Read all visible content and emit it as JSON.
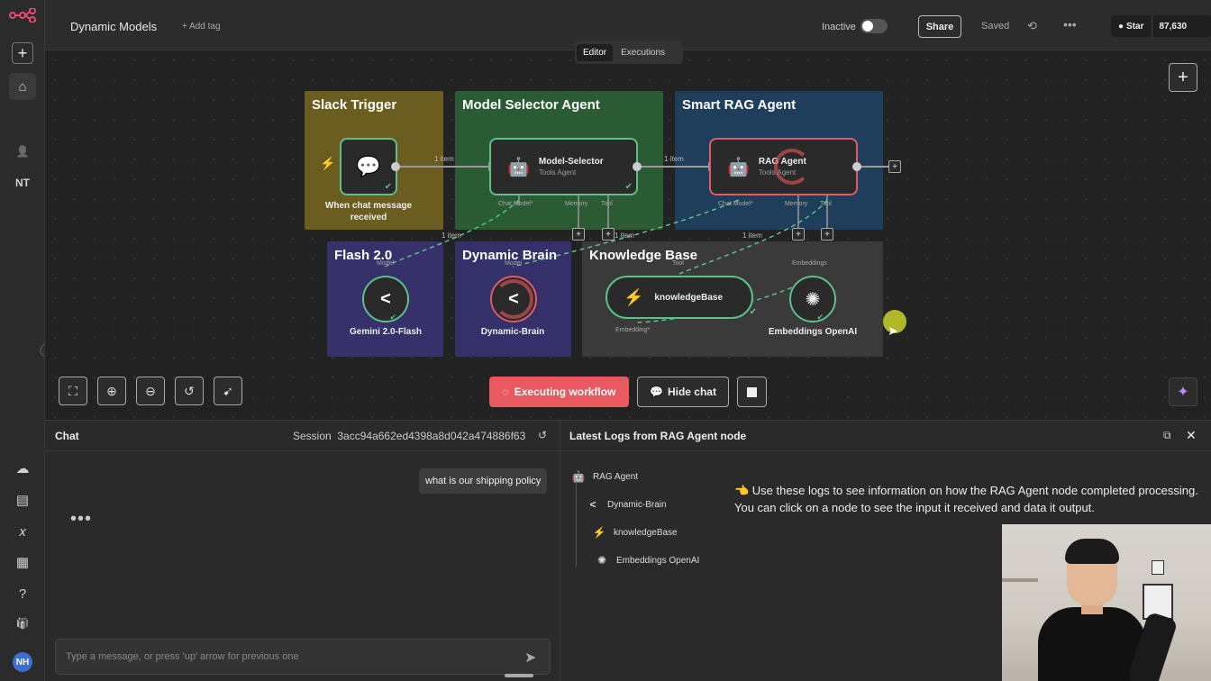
{
  "sidebar": {
    "items": [
      {
        "name": "add",
        "glyph": "+"
      },
      {
        "name": "home",
        "glyph": "⌂"
      },
      {
        "name": "user",
        "glyph": "👤"
      },
      {
        "name": "project",
        "glyph": "NT"
      },
      {
        "name": "cloud",
        "glyph": "☁"
      },
      {
        "name": "templates",
        "glyph": "▤"
      },
      {
        "name": "variables",
        "glyph": "𝑥"
      },
      {
        "name": "insights",
        "glyph": "▦"
      },
      {
        "name": "help",
        "glyph": "?"
      },
      {
        "name": "whats-new",
        "glyph": "🎁"
      }
    ],
    "avatar": "NH"
  },
  "header": {
    "title": "Dynamic Models",
    "add_tag": "+ Add tag",
    "status_label": "Inactive",
    "share": "Share",
    "saved": "Saved",
    "more": "•••",
    "github_star": "Star",
    "github_count": "87,630"
  },
  "tabs": [
    "Editor",
    "Executions"
  ],
  "groups": [
    {
      "title": "Slack Trigger",
      "color": "#6b5d1f"
    },
    {
      "title": "Model Selector Agent",
      "color": "#2a5b32"
    },
    {
      "title": "Smart RAG Agent",
      "color": "#1f3e5c"
    },
    {
      "title": "Flash 2.0",
      "color": "#36306b"
    },
    {
      "title": "Dynamic Brain",
      "color": "#33306a"
    },
    {
      "title": "Knowledge Base",
      "color": "#3a3a3a"
    }
  ],
  "nodes": {
    "trigger": {
      "label": "When chat message received"
    },
    "model_selector": {
      "title": "Model-Selector",
      "subtitle": "Tools Agent"
    },
    "rag_agent": {
      "title": "RAG Agent",
      "subtitle": "Tools Agent"
    },
    "gemini": {
      "label": "Gemini 2.0-Flash"
    },
    "dynamic_brain": {
      "label": "Dynamic-Brain"
    },
    "knowledge_base": {
      "title": "knowledgeBase"
    },
    "embeddings": {
      "label": "Embeddings OpenAI"
    }
  },
  "connections": {
    "item_label": "1 item"
  },
  "ports": {
    "chat_model": "Chat Model*",
    "memory": "Memory",
    "tool": "Tool",
    "model": "Model",
    "embeddings": "Embeddings",
    "embedding": "Embedding*"
  },
  "canvas_controls": {
    "executing": "Executing workflow",
    "hide_chat": "Hide chat"
  },
  "chat": {
    "title": "Chat",
    "session_label": "Session",
    "session_id": "3acc94a662ed4398a8d042a474886f63",
    "user_message": "what is our shipping policy",
    "typing": "•••",
    "input_placeholder": "Type a message, or press 'up' arrow for previous one"
  },
  "logs": {
    "title": "Latest Logs from RAG Agent node",
    "tree": [
      {
        "label": "RAG Agent",
        "icon": "robot-icon"
      },
      {
        "label": "Dynamic-Brain",
        "icon": "model-selector-icon"
      },
      {
        "label": "knowledgeBase",
        "icon": "bolt-icon"
      },
      {
        "label": "Embeddings OpenAI",
        "icon": "openai-icon"
      }
    ],
    "hint": "👈 Use these logs to see information on how the RAG Agent node completed processing. You can click on a node to see the input it received and data it output."
  },
  "colors": {
    "accent": "#e9595f",
    "success": "#5dbf8a",
    "error": "#e05a6a"
  }
}
